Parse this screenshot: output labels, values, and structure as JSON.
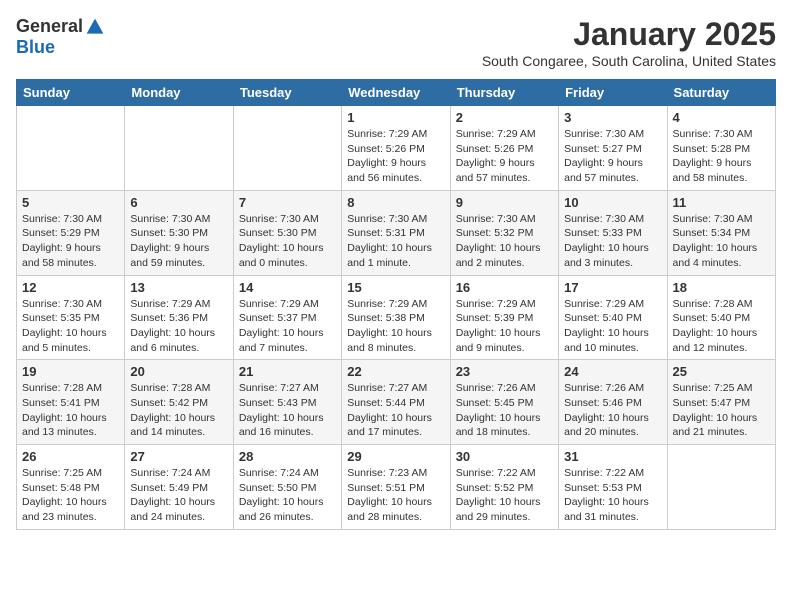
{
  "header": {
    "logo_general": "General",
    "logo_blue": "Blue",
    "month_title": "January 2025",
    "location": "South Congaree, South Carolina, United States"
  },
  "weekdays": [
    "Sunday",
    "Monday",
    "Tuesday",
    "Wednesday",
    "Thursday",
    "Friday",
    "Saturday"
  ],
  "weeks": [
    [
      {
        "day": "",
        "info": ""
      },
      {
        "day": "",
        "info": ""
      },
      {
        "day": "",
        "info": ""
      },
      {
        "day": "1",
        "info": "Sunrise: 7:29 AM\nSunset: 5:26 PM\nDaylight: 9 hours\nand 56 minutes."
      },
      {
        "day": "2",
        "info": "Sunrise: 7:29 AM\nSunset: 5:26 PM\nDaylight: 9 hours\nand 57 minutes."
      },
      {
        "day": "3",
        "info": "Sunrise: 7:30 AM\nSunset: 5:27 PM\nDaylight: 9 hours\nand 57 minutes."
      },
      {
        "day": "4",
        "info": "Sunrise: 7:30 AM\nSunset: 5:28 PM\nDaylight: 9 hours\nand 58 minutes."
      }
    ],
    [
      {
        "day": "5",
        "info": "Sunrise: 7:30 AM\nSunset: 5:29 PM\nDaylight: 9 hours\nand 58 minutes."
      },
      {
        "day": "6",
        "info": "Sunrise: 7:30 AM\nSunset: 5:30 PM\nDaylight: 9 hours\nand 59 minutes."
      },
      {
        "day": "7",
        "info": "Sunrise: 7:30 AM\nSunset: 5:30 PM\nDaylight: 10 hours\nand 0 minutes."
      },
      {
        "day": "8",
        "info": "Sunrise: 7:30 AM\nSunset: 5:31 PM\nDaylight: 10 hours\nand 1 minute."
      },
      {
        "day": "9",
        "info": "Sunrise: 7:30 AM\nSunset: 5:32 PM\nDaylight: 10 hours\nand 2 minutes."
      },
      {
        "day": "10",
        "info": "Sunrise: 7:30 AM\nSunset: 5:33 PM\nDaylight: 10 hours\nand 3 minutes."
      },
      {
        "day": "11",
        "info": "Sunrise: 7:30 AM\nSunset: 5:34 PM\nDaylight: 10 hours\nand 4 minutes."
      }
    ],
    [
      {
        "day": "12",
        "info": "Sunrise: 7:30 AM\nSunset: 5:35 PM\nDaylight: 10 hours\nand 5 minutes."
      },
      {
        "day": "13",
        "info": "Sunrise: 7:29 AM\nSunset: 5:36 PM\nDaylight: 10 hours\nand 6 minutes."
      },
      {
        "day": "14",
        "info": "Sunrise: 7:29 AM\nSunset: 5:37 PM\nDaylight: 10 hours\nand 7 minutes."
      },
      {
        "day": "15",
        "info": "Sunrise: 7:29 AM\nSunset: 5:38 PM\nDaylight: 10 hours\nand 8 minutes."
      },
      {
        "day": "16",
        "info": "Sunrise: 7:29 AM\nSunset: 5:39 PM\nDaylight: 10 hours\nand 9 minutes."
      },
      {
        "day": "17",
        "info": "Sunrise: 7:29 AM\nSunset: 5:40 PM\nDaylight: 10 hours\nand 10 minutes."
      },
      {
        "day": "18",
        "info": "Sunrise: 7:28 AM\nSunset: 5:40 PM\nDaylight: 10 hours\nand 12 minutes."
      }
    ],
    [
      {
        "day": "19",
        "info": "Sunrise: 7:28 AM\nSunset: 5:41 PM\nDaylight: 10 hours\nand 13 minutes."
      },
      {
        "day": "20",
        "info": "Sunrise: 7:28 AM\nSunset: 5:42 PM\nDaylight: 10 hours\nand 14 minutes."
      },
      {
        "day": "21",
        "info": "Sunrise: 7:27 AM\nSunset: 5:43 PM\nDaylight: 10 hours\nand 16 minutes."
      },
      {
        "day": "22",
        "info": "Sunrise: 7:27 AM\nSunset: 5:44 PM\nDaylight: 10 hours\nand 17 minutes."
      },
      {
        "day": "23",
        "info": "Sunrise: 7:26 AM\nSunset: 5:45 PM\nDaylight: 10 hours\nand 18 minutes."
      },
      {
        "day": "24",
        "info": "Sunrise: 7:26 AM\nSunset: 5:46 PM\nDaylight: 10 hours\nand 20 minutes."
      },
      {
        "day": "25",
        "info": "Sunrise: 7:25 AM\nSunset: 5:47 PM\nDaylight: 10 hours\nand 21 minutes."
      }
    ],
    [
      {
        "day": "26",
        "info": "Sunrise: 7:25 AM\nSunset: 5:48 PM\nDaylight: 10 hours\nand 23 minutes."
      },
      {
        "day": "27",
        "info": "Sunrise: 7:24 AM\nSunset: 5:49 PM\nDaylight: 10 hours\nand 24 minutes."
      },
      {
        "day": "28",
        "info": "Sunrise: 7:24 AM\nSunset: 5:50 PM\nDaylight: 10 hours\nand 26 minutes."
      },
      {
        "day": "29",
        "info": "Sunrise: 7:23 AM\nSunset: 5:51 PM\nDaylight: 10 hours\nand 28 minutes."
      },
      {
        "day": "30",
        "info": "Sunrise: 7:22 AM\nSunset: 5:52 PM\nDaylight: 10 hours\nand 29 minutes."
      },
      {
        "day": "31",
        "info": "Sunrise: 7:22 AM\nSunset: 5:53 PM\nDaylight: 10 hours\nand 31 minutes."
      },
      {
        "day": "",
        "info": ""
      }
    ]
  ]
}
